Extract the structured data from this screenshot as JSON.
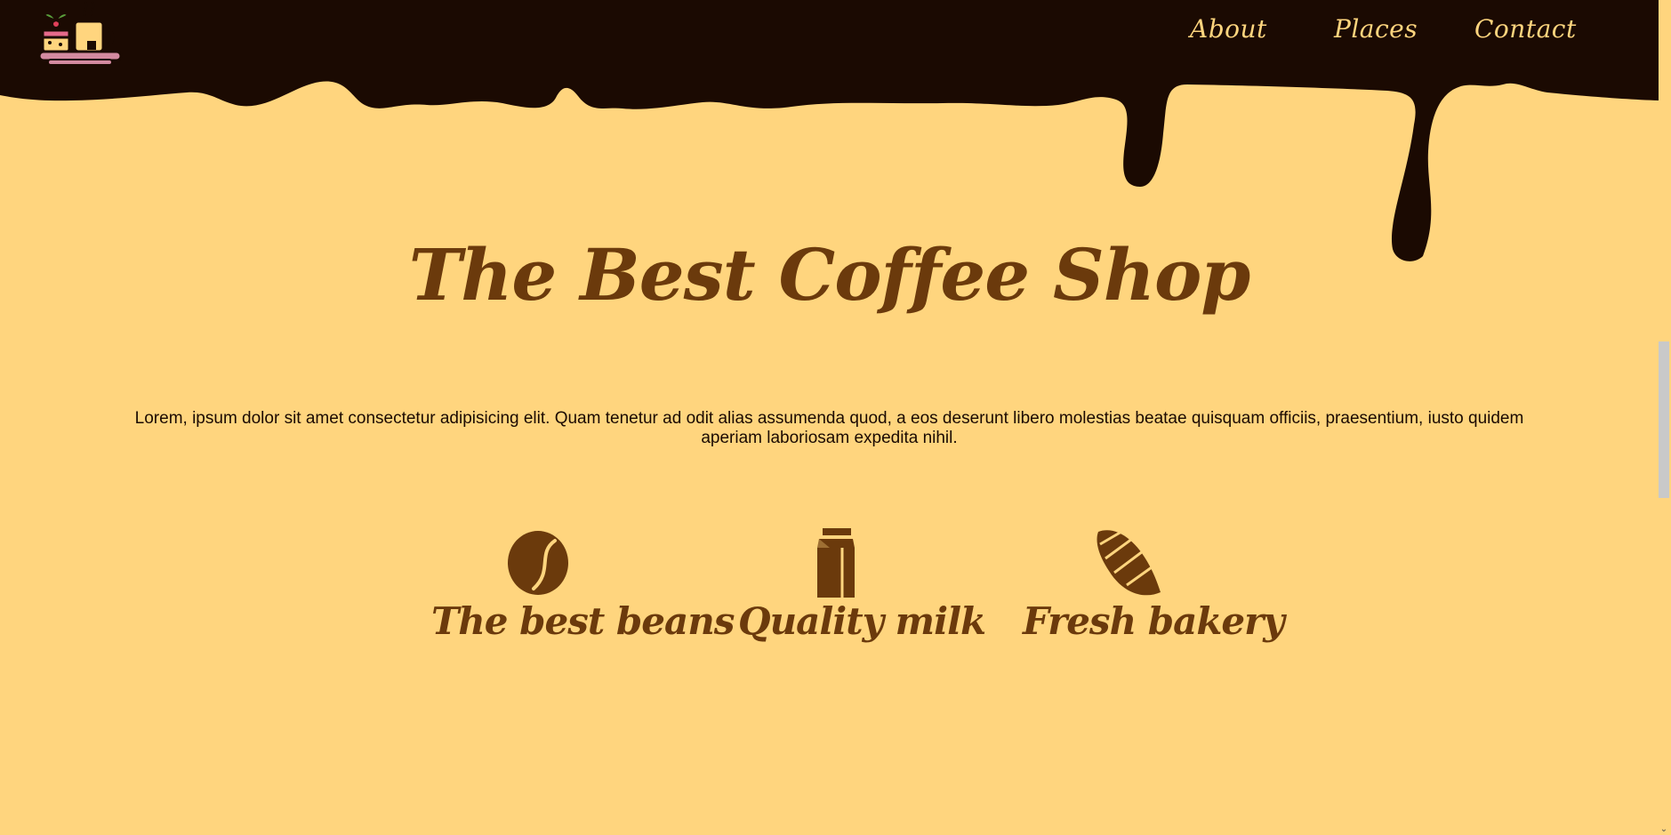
{
  "header": {
    "logo": "coffee-cake-logo-icon",
    "nav": [
      {
        "label": "About"
      },
      {
        "label": "Places"
      },
      {
        "label": "Contact"
      }
    ]
  },
  "hero": {
    "title": "The Best Coffee Shop",
    "intro": "Lorem, ipsum dolor sit amet consectetur adipisicing elit. Quam tenetur ad odit alias assumenda quod, a eos deserunt libero molestias beatae quisquam officiis, praesentium, iusto quidem aperiam laboriosam expedita nihil."
  },
  "features": [
    {
      "icon": "coffee-bean-icon",
      "label": "The best beans"
    },
    {
      "icon": "milk-carton-icon",
      "label": "Quality milk"
    },
    {
      "icon": "croissant-icon",
      "label": "Fresh bakery"
    }
  ],
  "colors": {
    "background": "#ffd57e",
    "chocolate": "#1b0a02",
    "accent_brown": "#6b3a0c"
  }
}
